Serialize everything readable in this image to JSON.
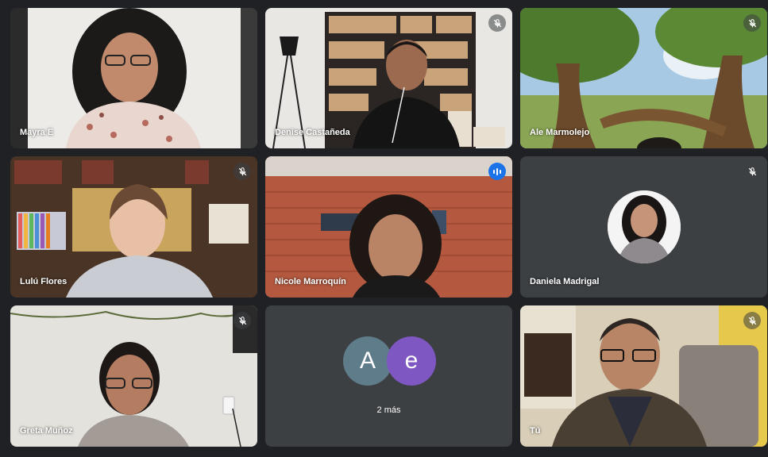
{
  "participants": [
    {
      "name": "Mayra E",
      "muted": false
    },
    {
      "name": "Denise Castañeda",
      "muted": true
    },
    {
      "name": "Ale Marmolejo",
      "muted": true
    },
    {
      "name": "Lulú Flores",
      "muted": true
    },
    {
      "name": "Nicole Marroquín",
      "muted": false,
      "speaking": true
    },
    {
      "name": "Daniela Madrigal",
      "muted": true
    },
    {
      "name": "Greta Muñoz",
      "muted": true
    },
    {
      "name": "Tú",
      "muted": true
    }
  ],
  "overflow": {
    "avatars": [
      {
        "letter": "A",
        "color": "#5f7c8a"
      },
      {
        "letter": "e",
        "color": "#7e57c2"
      }
    ],
    "label": "2 más"
  },
  "colors": {
    "background": "#202124",
    "tile": "#3c4043",
    "active_border": "#8ab4f8",
    "speaking_badge": "#1a73e8"
  },
  "icons": {
    "muted": "mic-off-icon",
    "speaking": "audio-level-icon"
  }
}
